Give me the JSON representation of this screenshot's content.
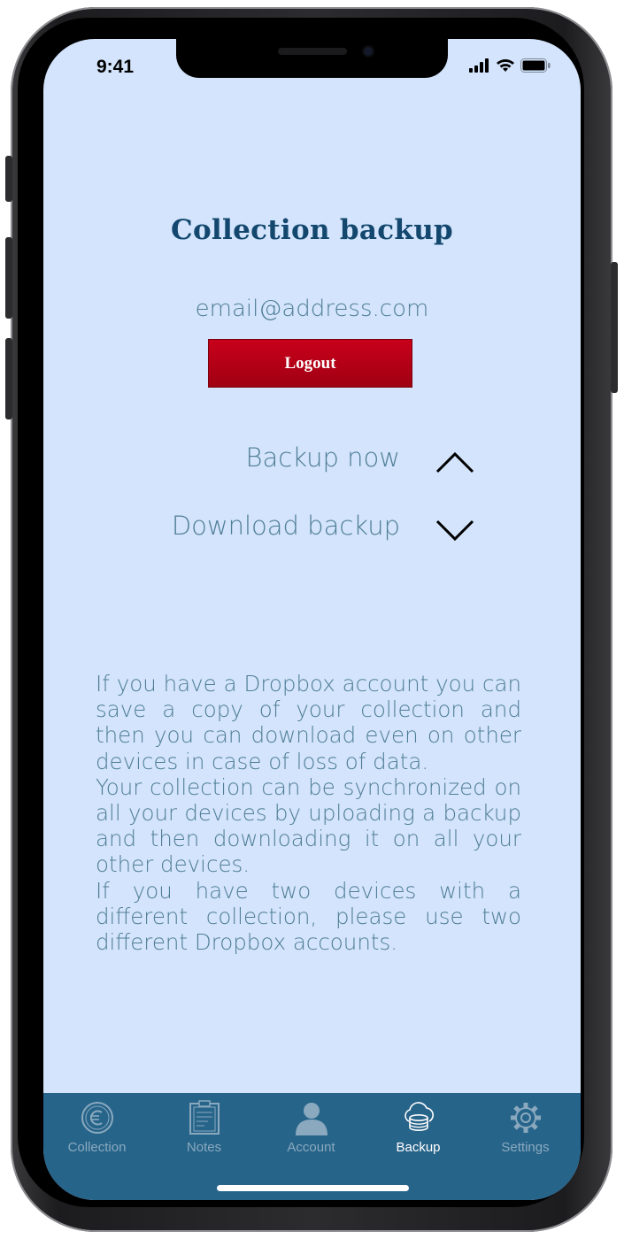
{
  "status_bar": {
    "time": "9:41",
    "icons": [
      "cellular-signal-icon",
      "wifi-icon",
      "battery-icon"
    ]
  },
  "page": {
    "title": "Collection backup",
    "email": "email@address.com",
    "logout_label": "Logout"
  },
  "actions": [
    {
      "label": "Backup now",
      "icon": "chevron-up-icon"
    },
    {
      "label": "Download backup",
      "icon": "chevron-down-icon"
    }
  ],
  "info_paragraphs": [
    "If you have a Dropbox account you can save a copy of your collection and then you can download even on other devices in case of loss of data.",
    "Your collection can be synchronized on all your devices by uploading a backup and then downloading it on all your other devices.",
    "If you have two devices with a different collection, please use two different Dropbox accounts."
  ],
  "tabbar": {
    "active": "Backup",
    "tabs": [
      {
        "label": "Collection",
        "icon": "euro-coin-icon"
      },
      {
        "label": "Notes",
        "icon": "clipboard-icon"
      },
      {
        "label": "Account",
        "icon": "person-icon"
      },
      {
        "label": "Backup",
        "icon": "cloud-database-icon"
      },
      {
        "label": "Settings",
        "icon": "gear-icon"
      }
    ]
  },
  "colors": {
    "background": "#d3e4fc",
    "title": "#13476e",
    "body_text": "#4f7e96",
    "logout_button": "#b8001a",
    "tabbar": "#27648a",
    "tab_inactive": "#8aa9be",
    "tab_active": "#ffffff"
  }
}
